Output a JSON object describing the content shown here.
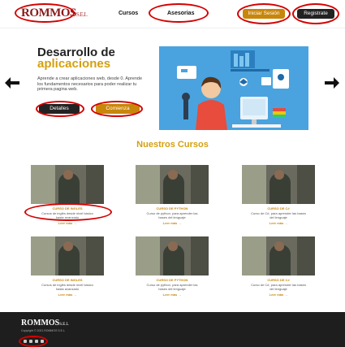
{
  "nav": {
    "logo": "ROMMOS",
    "logo_suffix": "S.E.L",
    "links": [
      "Cursos",
      "Asesorias"
    ],
    "login_label": "Iniciar Sesión",
    "register_label": "Registrate"
  },
  "hero": {
    "title": "Desarrollo de",
    "subtitle": "aplicaciones",
    "description": "Aprende a crear aplicaciones web, desde 0. Aprende los fundamentos necesarios para poder realizar tu primera pagina web.",
    "details_label": "Detalles",
    "start_label": "Comienza",
    "prev_icon": "arrow-left-icon",
    "next_icon": "arrow-right-icon"
  },
  "courses": {
    "title": "Nuestros Cursos",
    "items": [
      {
        "title": "CURSO DE INGLES",
        "desc": "Cursos de inglés desde nivel básico hasta avanzado",
        "more": "Leer más →"
      },
      {
        "title": "CURSO DE PYTHON",
        "desc": "Curso de python, para aprender las bases del lenguaje",
        "more": "Leer más →"
      },
      {
        "title": "CURSO DE C#",
        "desc": "Curso de C#, para aprender las bases del lenguaje",
        "more": "Leer más →"
      },
      {
        "title": "CURSO DE INGLES",
        "desc": "Cursos de inglés desde nivel básico hasta avanzado",
        "more": "Leer más →"
      },
      {
        "title": "CURSO DE PYTHON",
        "desc": "Curso de python, para aprender las bases del lenguaje",
        "more": "Leer más →"
      },
      {
        "title": "CURSO DE C#",
        "desc": "Curso de C#, para aprender las bases del lenguaje",
        "more": "Leer más →"
      }
    ]
  },
  "footer": {
    "logo": "ROMMOS",
    "logo_suffix": "S.E.L",
    "text": "Copyright © 2021 ROMMOS S.E.L",
    "social_icons": [
      "facebook-icon",
      "twitter-icon",
      "instagram-icon",
      "youtube-icon"
    ]
  },
  "colors": {
    "accent": "#d4a010",
    "button_gold": "#c8860a",
    "dark": "#222222",
    "annotation": "#d40000",
    "hero_bg": "#4aa3df"
  }
}
